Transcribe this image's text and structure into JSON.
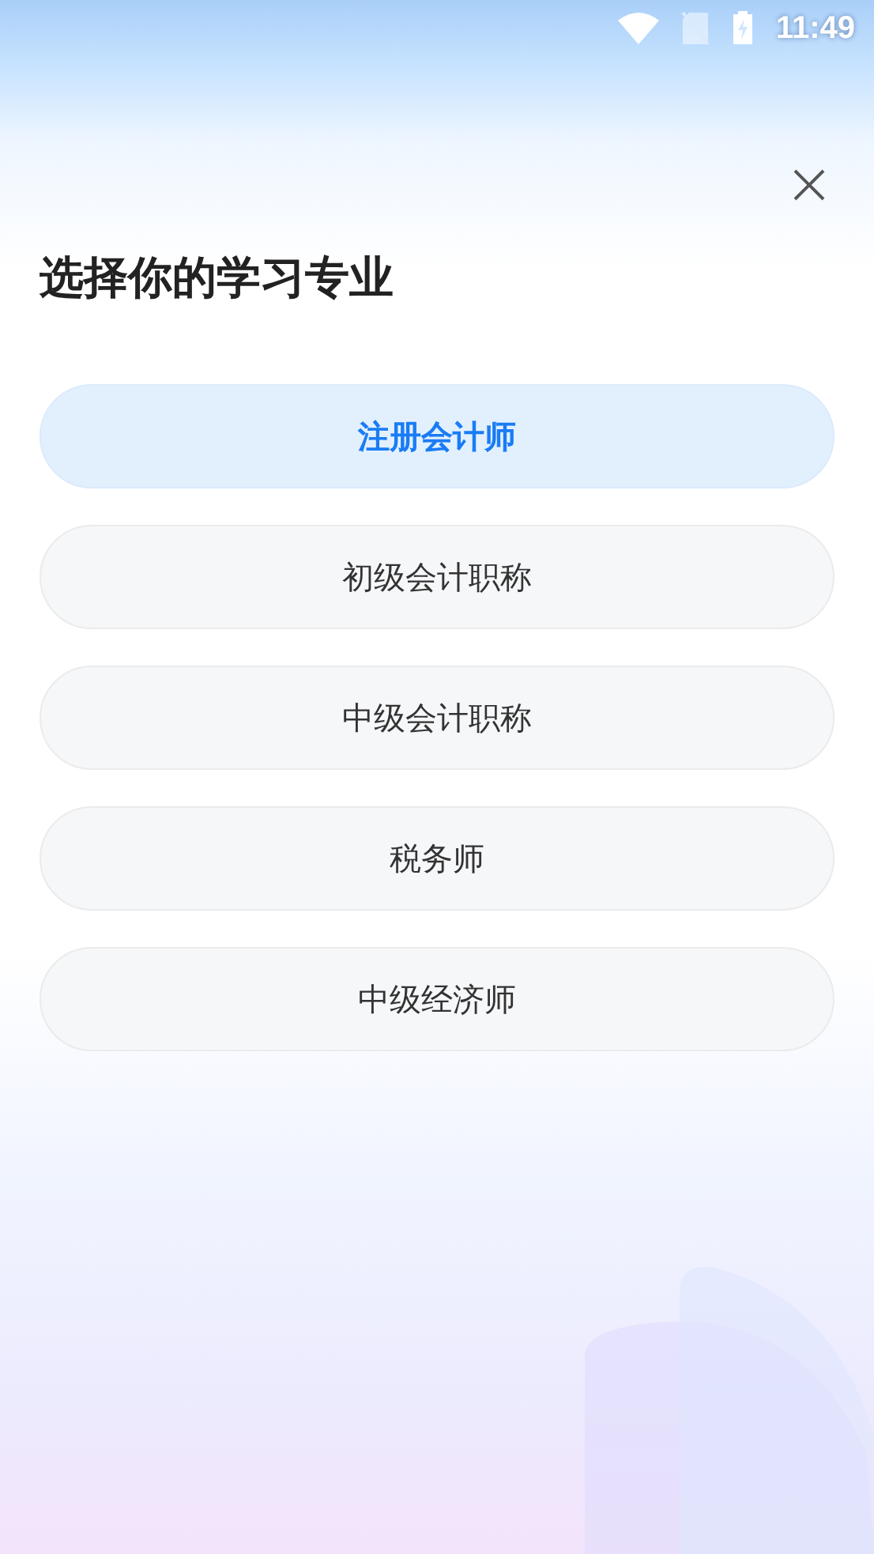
{
  "status_bar": {
    "time": "11:49"
  },
  "title": "选择你的学习专业",
  "options": [
    {
      "label": "注册会计师",
      "selected": true
    },
    {
      "label": "初级会计职称",
      "selected": false
    },
    {
      "label": "中级会计职称",
      "selected": false
    },
    {
      "label": "税务师",
      "selected": false
    },
    {
      "label": "中级经济师",
      "selected": false
    }
  ]
}
